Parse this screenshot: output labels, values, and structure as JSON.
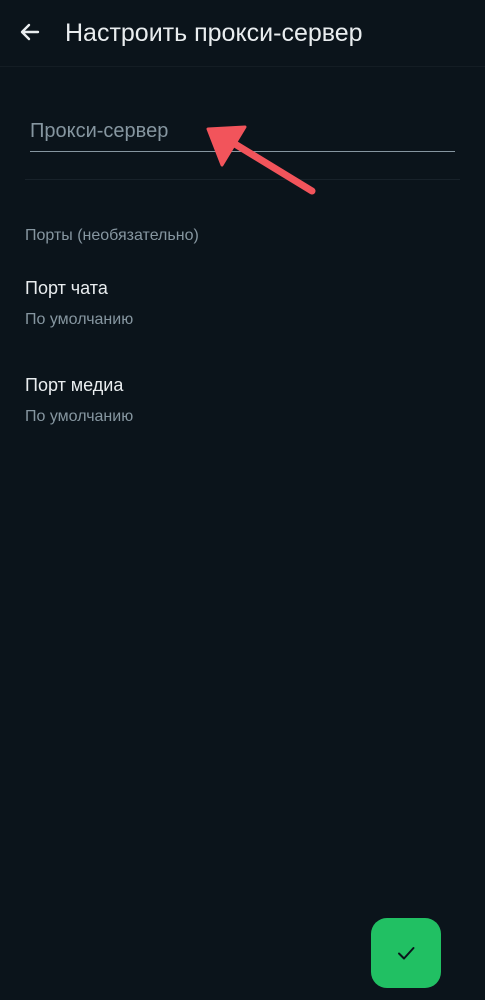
{
  "header": {
    "back_icon": "arrow-left-icon",
    "title": "Настроить прокси-сервер"
  },
  "proxy": {
    "placeholder": "Прокси-сервер",
    "value": ""
  },
  "ports": {
    "header": "Порты (необязательно)",
    "chat_port": {
      "label": "Порт чата",
      "value": "По умолчанию"
    },
    "media_port": {
      "label": "Порт медиа",
      "value": "По умолчанию"
    }
  },
  "fab": {
    "icon": "checkmark-icon"
  },
  "annotation": {
    "icon": "red-arrow-icon",
    "color": "#f2545b"
  },
  "colors": {
    "background": "#0b141b",
    "primary_text": "#e9edef",
    "secondary_text": "#8696a0",
    "accent_green": "#21c063"
  }
}
